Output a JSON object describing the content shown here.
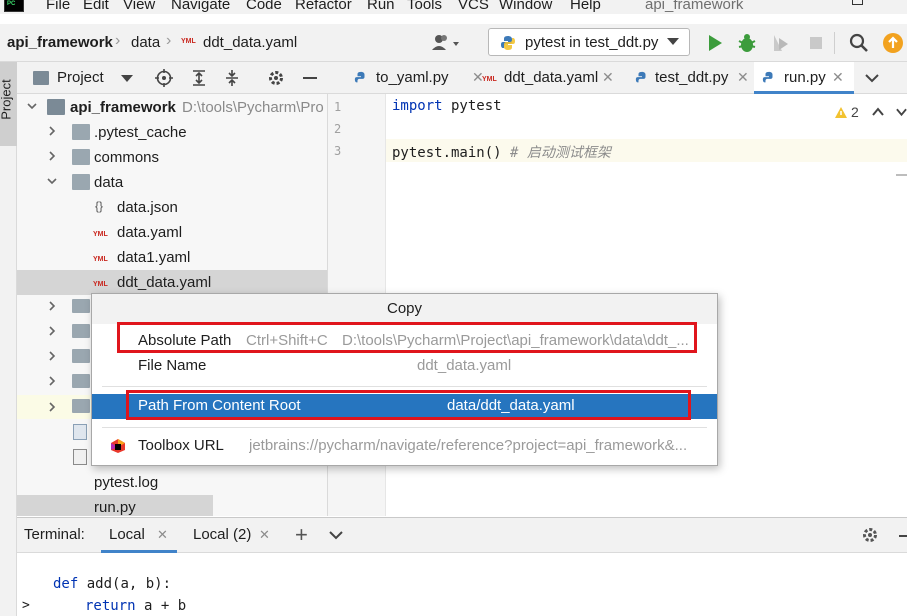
{
  "menubar": {
    "items": [
      "File",
      "Edit",
      "View",
      "Navigate",
      "Code",
      "Refactor",
      "Run",
      "Tools",
      "VCS",
      "Window",
      "Help"
    ],
    "app_title": "api_framework"
  },
  "navbar": {
    "crumbs": [
      "api_framework",
      "data",
      "ddt_data.yaml"
    ],
    "run_config": "pytest in test_ddt.py"
  },
  "left_stripe": {
    "project_tab": "Project"
  },
  "project": {
    "title": "Project",
    "root": {
      "name": "api_framework",
      "path": "D:\\tools\\Pycharm\\Pro"
    },
    "items": [
      {
        "name": ".pytest_cache"
      },
      {
        "name": "commons"
      },
      {
        "name": "data"
      },
      {
        "name": "data.json"
      },
      {
        "name": "data.yaml"
      },
      {
        "name": "data1.yaml"
      },
      {
        "name": "ddt_data.yaml"
      },
      {
        "name": "pytest.log"
      },
      {
        "name": "run.py"
      }
    ]
  },
  "editor": {
    "tabs": [
      {
        "label": "to_yaml.py"
      },
      {
        "label": "ddt_data.yaml"
      },
      {
        "label": "test_ddt.py"
      },
      {
        "label": "run.py"
      }
    ],
    "line_numbers": [
      "1",
      "2",
      "3"
    ],
    "lines": {
      "l1_kw": "import",
      "l1_rest": " pytest",
      "l3_code": "pytest.main() ",
      "l3_comment": "# 启动测试框架"
    },
    "warnings": "2"
  },
  "copy_menu": {
    "title": "Copy",
    "items": [
      {
        "name": "Absolute Path",
        "shortcut": "Ctrl+Shift+C",
        "value": "D:\\tools\\Pycharm\\Project\\api_framework\\data\\ddt_..."
      },
      {
        "name": "File Name",
        "shortcut": "",
        "value": "ddt_data.yaml"
      },
      {
        "name": "Path From Content Root",
        "shortcut": "",
        "value": "data/ddt_data.yaml"
      },
      {
        "name": "Toolbox URL",
        "shortcut": "",
        "value": "jetbrains://pycharm/navigate/reference?project=api_framework&..."
      }
    ]
  },
  "terminal": {
    "label": "Terminal:",
    "tabs": [
      "Local",
      "Local (2)"
    ],
    "lines": {
      "l1_kw": "def",
      "l1_rest": " add(a, b):",
      "l2_kw": "return",
      "l2_rest": " a + b"
    },
    "prompt": ">"
  },
  "colors": {
    "accent": "#2675bf",
    "highlight_box": "#e0151c",
    "run_green": "#3c9c3c"
  }
}
